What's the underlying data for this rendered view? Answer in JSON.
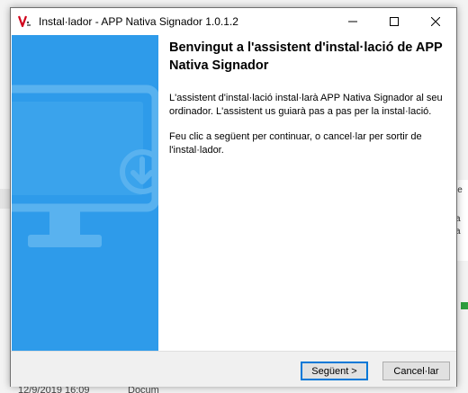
{
  "background": {
    "right_texts": [
      "ie",
      "a",
      "a"
    ],
    "bottom_date": "12/9/2019 16:09",
    "bottom_type": "Docum"
  },
  "window": {
    "title": "Instal·lador - APP Nativa Signador 1.0.1.2",
    "icon": "app-logo-icon",
    "controls": [
      "minimize-icon",
      "maximize-icon",
      "close-icon"
    ]
  },
  "banner": {
    "color": "#2e9bea",
    "icon": "monitor-download-icon"
  },
  "content": {
    "heading": "Benvingut a l'assistent d'instal·lació de APP Nativa Signador",
    "paragraph1": "L'assistent d'instal·lació instal·larà APP Nativa Signador al seu ordinador. L'assistent us guiarà pas a pas per la instal·lació.",
    "paragraph2": "Feu clic a següent per continuar, o cancel·lar per sortir de l'instal·lador."
  },
  "buttons": {
    "next_label": "Següent >",
    "cancel_label": "Cancel·lar"
  },
  "colors": {
    "accent": "#0078d7",
    "logo_red": "#d0021b"
  }
}
